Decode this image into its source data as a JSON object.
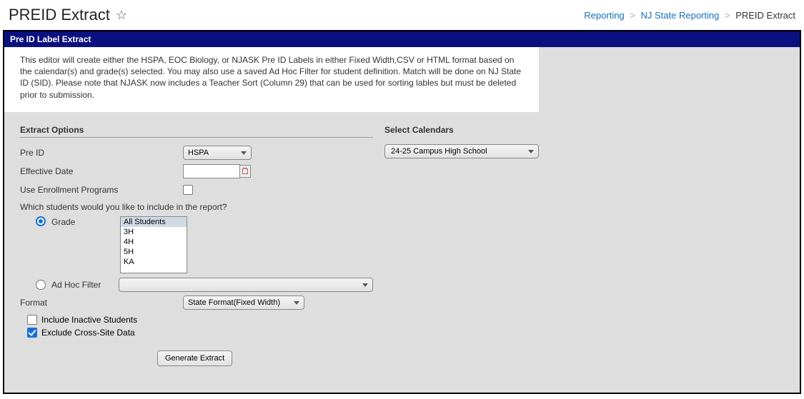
{
  "header": {
    "title": "PREID Extract"
  },
  "breadcrumb": {
    "item1": "Reporting",
    "item2": "NJ State Reporting",
    "current": "PREID Extract"
  },
  "panel": {
    "title": "Pre ID Label Extract",
    "info": "This editor will create either the HSPA, EOC Biology, or NJASK Pre ID Labels in either Fixed Width,CSV or HTML format based on the calendar(s) and grade(s) selected. You may also use a saved Ad Hoc Filter for student definition. Match will be done on NJ State ID (SID). Please note that NJASK now includes a Teacher Sort (Column 29) that can be used for sorting lables but must be deleted prior to submission."
  },
  "sections": {
    "extract": "Extract Options",
    "calendars": "Select Calendars"
  },
  "labels": {
    "preid": "Pre ID",
    "effective": "Effective Date",
    "useEnroll": "Use Enrollment Programs",
    "question": "Which students would you like to include in the report?",
    "grade": "Grade",
    "adhoc": "Ad Hoc Filter",
    "format": "Format",
    "includeInactive": "Include Inactive Students",
    "excludeCross": "Exclude Cross-Site Data"
  },
  "values": {
    "preidSelected": "HSPA",
    "effectiveDate": "",
    "formatSelected": "State Format(Fixed Width)",
    "calendarSelected": "24-25 Campus High School",
    "adhocSelected": ""
  },
  "gradeOptions": {
    "o0": "All Students",
    "o1": "3H",
    "o2": "4H",
    "o3": "5H",
    "o4": "KA"
  },
  "buttons": {
    "generate": "Generate Extract"
  }
}
